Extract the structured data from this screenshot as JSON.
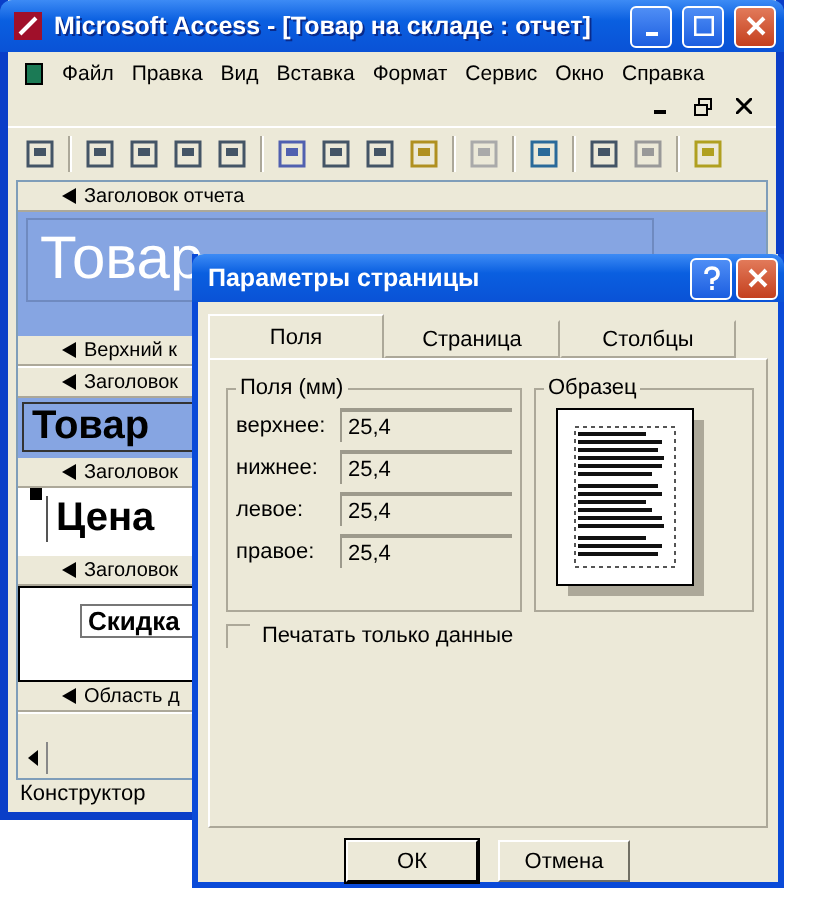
{
  "window": {
    "title": "Microsoft Access - [Товар на складе : отчет]"
  },
  "menu": [
    "Файл",
    "Правка",
    "Вид",
    "Вставка",
    "Формат",
    "Сервис",
    "Окно",
    "Справка"
  ],
  "report": {
    "sections": [
      {
        "band": "Заголовок отчета",
        "kind": "title",
        "text": "Товар"
      },
      {
        "band": "Верхний к",
        "kind": "empty"
      },
      {
        "band": "Заголовок",
        "kind": "group",
        "text": "Товар"
      },
      {
        "band": "Заголовок",
        "kind": "label",
        "text": "Цена"
      },
      {
        "band": "Заголовок",
        "kind": "field",
        "text": "Скидка"
      },
      {
        "band": "Область д",
        "kind": "empty"
      }
    ]
  },
  "status_bar": "Конструктор",
  "dialog": {
    "title": "Параметры страницы",
    "tabs": [
      {
        "label": "Поля",
        "selected": true
      },
      {
        "label": "Страница",
        "selected": false
      },
      {
        "label": "Столбцы",
        "selected": false
      }
    ],
    "margins_group": "Поля (мм)",
    "margins": [
      {
        "label": "верхнее:",
        "value": "25,4"
      },
      {
        "label": "нижнее:",
        "value": "25,4"
      },
      {
        "label": "левое:",
        "value": "25,4"
      },
      {
        "label": "правое:",
        "value": "25,4"
      }
    ],
    "sample_group": "Образец",
    "print_data_only": {
      "label": "Печатать только данные",
      "checked": false
    },
    "buttons": [
      {
        "label": "ОК",
        "default": true
      },
      {
        "label": "Отмена",
        "default": false
      }
    ]
  }
}
